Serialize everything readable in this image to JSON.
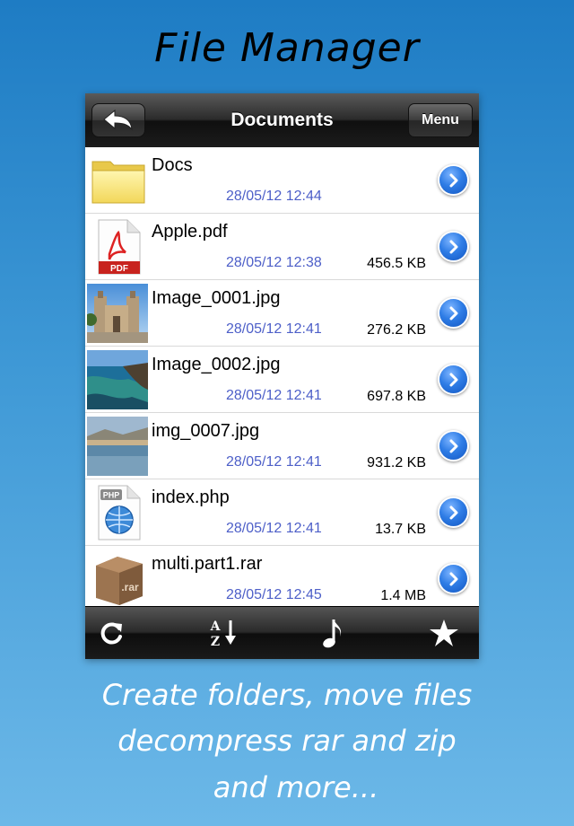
{
  "promo": {
    "title": "File Manager",
    "caption_lines": [
      "Create folders, move files",
      "decompress rar and zip",
      "and more..."
    ]
  },
  "navbar": {
    "title": "Documents",
    "back_icon": "back-arrow-icon",
    "menu_label": "Menu"
  },
  "files": [
    {
      "name": "Docs",
      "date": "28/05/12 12:44",
      "size": "",
      "icon": "folder-icon"
    },
    {
      "name": "Apple.pdf",
      "date": "28/05/12 12:38",
      "size": "456.5 KB",
      "icon": "pdf-icon",
      "icon_label": "PDF"
    },
    {
      "name": "Image_0001.jpg",
      "date": "28/05/12 12:41",
      "size": "276.2 KB",
      "icon": "image-thumbnail"
    },
    {
      "name": "Image_0002.jpg",
      "date": "28/05/12 12:41",
      "size": "697.8 KB",
      "icon": "image-thumbnail"
    },
    {
      "name": "img_0007.jpg",
      "date": "28/05/12 12:41",
      "size": "931.2 KB",
      "icon": "image-thumbnail"
    },
    {
      "name": "index.php",
      "date": "28/05/12 12:41",
      "size": "13.7 KB",
      "icon": "php-icon",
      "icon_label": "PHP"
    },
    {
      "name": "multi.part1.rar",
      "date": "28/05/12 12:45",
      "size": "1.4 MB",
      "icon": "rar-icon",
      "icon_label": ".rar"
    }
  ],
  "toolbar": {
    "items": [
      "refresh-icon",
      "sort-az-icon",
      "music-note-icon",
      "star-icon"
    ],
    "sort_glyph_top": "A",
    "sort_glyph_bottom": "Z"
  },
  "colors": {
    "date_text": "#4d5fc8",
    "disclosure_blue": "#2f7de6",
    "background_top": "#1e7cc4",
    "background_bottom": "#6cb8e8"
  }
}
